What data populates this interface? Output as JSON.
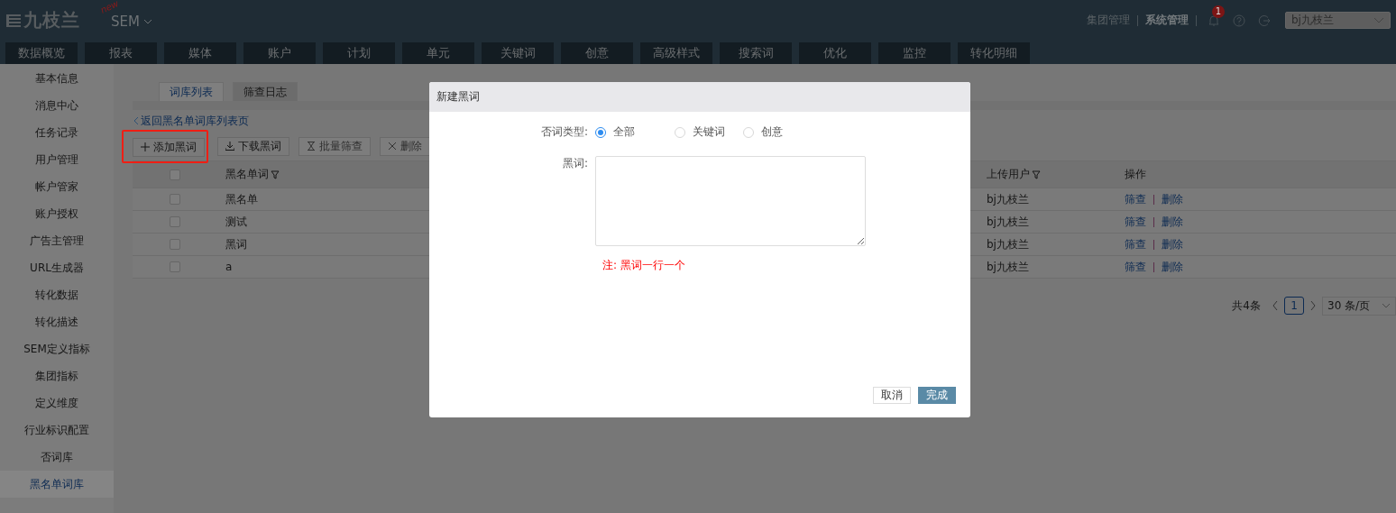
{
  "header": {
    "logo": "九枝兰",
    "new_tag": "new",
    "product": "SEM",
    "links": [
      {
        "label": "集团管理",
        "selected": false
      },
      {
        "label": "系统管理",
        "selected": true
      }
    ],
    "notification_count": "1",
    "account": "bj九枝兰"
  },
  "nav_tabs": [
    {
      "label": "数据概览"
    },
    {
      "label": "报表"
    },
    {
      "label": "媒体"
    },
    {
      "label": "账户"
    },
    {
      "label": "计划"
    },
    {
      "label": "单元"
    },
    {
      "label": "关键词"
    },
    {
      "label": "创意"
    },
    {
      "label": "高级样式"
    },
    {
      "label": "搜索词"
    },
    {
      "label": "优化"
    },
    {
      "label": "监控"
    },
    {
      "label": "转化明细"
    }
  ],
  "sidebar": {
    "items": [
      {
        "label": "基本信息",
        "selected": false
      },
      {
        "label": "消息中心",
        "selected": false
      },
      {
        "label": "任务记录",
        "selected": false
      },
      {
        "label": "用户管理",
        "selected": false
      },
      {
        "label": "帐户管家",
        "selected": false
      },
      {
        "label": "账户授权",
        "selected": false
      },
      {
        "label": "广告主管理",
        "selected": false
      },
      {
        "label": "URL生成器",
        "selected": false
      },
      {
        "label": "转化数据",
        "selected": false
      },
      {
        "label": "转化描述",
        "selected": false
      },
      {
        "label": "SEM定义指标",
        "selected": false
      },
      {
        "label": "集团指标",
        "selected": false
      },
      {
        "label": "定义维度",
        "selected": false
      },
      {
        "label": "行业标识配置",
        "selected": false
      },
      {
        "label": "否词库",
        "selected": false
      },
      {
        "label": "黑名单词库",
        "selected": true
      }
    ]
  },
  "content": {
    "tabs": [
      {
        "label": "词库列表",
        "selected": true
      },
      {
        "label": "筛查日志",
        "selected": false
      }
    ],
    "back_link": "返回黑名单词库列表页",
    "toolbar": [
      {
        "label": "添加黑词",
        "disabled": false,
        "highlighted": true
      },
      {
        "label": "下载黑词",
        "disabled": false,
        "highlighted": false
      },
      {
        "label": "批量筛查",
        "disabled": true,
        "highlighted": false
      },
      {
        "label": "删除",
        "disabled": true,
        "highlighted": false
      }
    ],
    "table": {
      "select_all_checked": false,
      "columns": [
        {
          "label": "黑名单词",
          "filter": true
        },
        {
          "label": "上传用户",
          "filter": true
        },
        {
          "label": "操作",
          "filter": false
        }
      ],
      "rows": [
        {
          "checked": false,
          "word": "黑名单",
          "user": "bj九枝兰",
          "actions": [
            "筛查",
            "删除"
          ]
        },
        {
          "checked": false,
          "word": "测试",
          "user": "bj九枝兰",
          "actions": [
            "筛查",
            "删除"
          ]
        },
        {
          "checked": false,
          "word": "黑词",
          "user": "bj九枝兰",
          "actions": [
            "筛查",
            "删除"
          ]
        },
        {
          "checked": false,
          "word": "a",
          "user": "bj九枝兰",
          "actions": [
            "筛查",
            "删除"
          ]
        }
      ]
    },
    "pagination": {
      "total": "共4条",
      "pages": [
        {
          "label": "1",
          "selected": true
        }
      ],
      "page_size": "30 条/页"
    }
  },
  "modal": {
    "title": "新建黑词",
    "type_label": "否词类型:",
    "options": [
      {
        "label": "全部",
        "selected": true
      },
      {
        "label": "关键词",
        "selected": false
      },
      {
        "label": "创意",
        "selected": false
      }
    ],
    "word_label": "黑词:",
    "note": "注: 黑词一行一个",
    "buttons": [
      {
        "label": "取消",
        "kind": "secondary"
      },
      {
        "label": "完成",
        "kind": "primary"
      }
    ]
  }
}
